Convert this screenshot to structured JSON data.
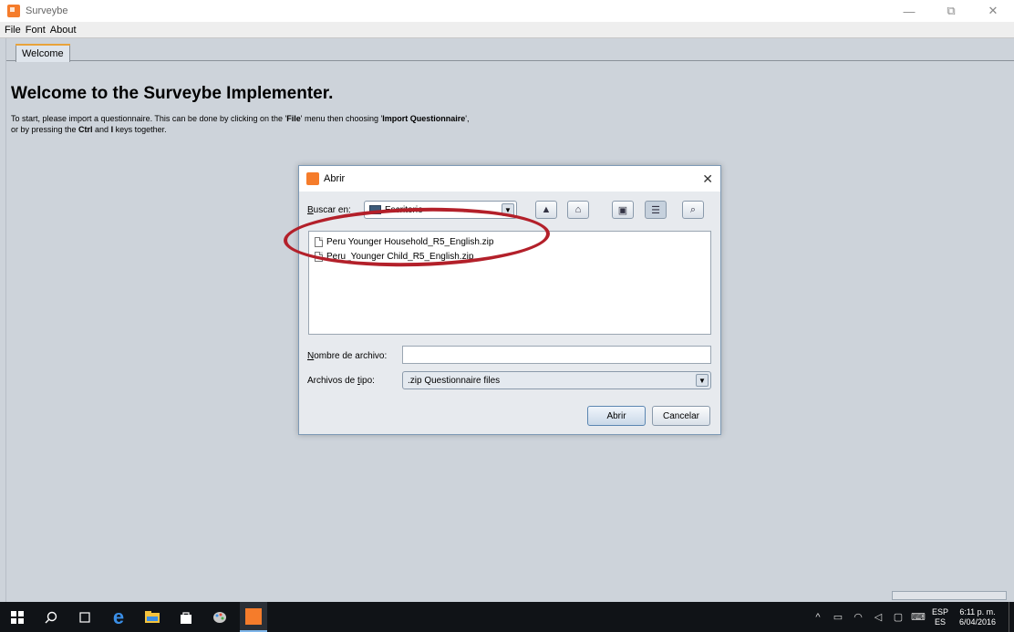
{
  "app": {
    "title": "Surveybe",
    "window_controls": {
      "minimize": "—",
      "restore": "⧉",
      "close": "✕"
    }
  },
  "menu": [
    "File",
    "Font",
    "About"
  ],
  "tabs": [
    {
      "label": "Welcome",
      "active": true
    }
  ],
  "welcome": {
    "heading": "Welcome to the Surveybe Implementer.",
    "line1_a": "To start, please import a questionnaire. This can be done by clicking on the '",
    "line1_file": "File",
    "line1_b": "' menu then choosing '",
    "line1_import": "Import Questionnaire",
    "line1_c": "',",
    "line2_a": "or by pressing the ",
    "line2_ctrl": "Ctrl",
    "line2_b": " and ",
    "line2_i": "I",
    "line2_c": " keys together."
  },
  "dialog": {
    "title": "Abrir",
    "close": "✕",
    "look_in_label": "Buscar en:",
    "look_in_value": "Escritorio",
    "toolbar_icons": [
      "up-folder-icon",
      "home-icon",
      "new-folder-icon",
      "list-view-icon",
      "details-view-icon"
    ],
    "files": [
      "Peru Younger Household_R5_English.zip",
      "Peru_Younger Child_R5_English.zip"
    ],
    "file_name_label": "Nombre de archivo:",
    "file_name_value": "",
    "file_type_label": "Archivos de tipo:",
    "file_type_value": ".zip Questionnaire files",
    "open_button": "Abrir",
    "cancel_button": "Cancelar"
  },
  "annotation": {
    "color": "#b3202a"
  },
  "taskbar": {
    "lang_top": "ESP",
    "lang_bottom": "ES",
    "time": "6:11 p. m.",
    "date": "6/04/2016"
  },
  "colors": {
    "accent": "#f57c2b",
    "background": "#cdd3da",
    "taskbar": "#101317"
  }
}
